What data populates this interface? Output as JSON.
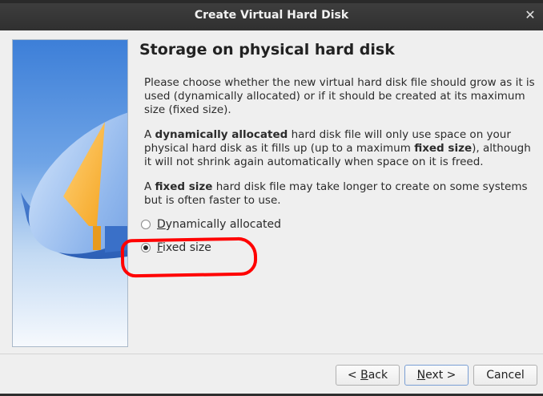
{
  "window": {
    "title": "Create Virtual Hard Disk",
    "close_icon": "close-icon"
  },
  "page": {
    "heading": "Storage on physical hard disk",
    "para1": "Please choose whether the new virtual hard disk file should grow as it is used (dynamically allocated) or if it should be created at its maximum size (fixed size).",
    "para2_prefix": "A ",
    "para2_bold1": "dynamically allocated",
    "para2_mid": " hard disk file will only use space on your physical hard disk as it fills up (up to a maximum ",
    "para2_bold2": "fixed size",
    "para2_suffix": "), although it will not shrink again automatically when space on it is freed.",
    "para3_prefix": "A ",
    "para3_bold": "fixed size",
    "para3_suffix": " hard disk file may take longer to create on some systems but is often faster to use."
  },
  "options": {
    "dynamic": {
      "label": "Dynamically allocated",
      "selected": false
    },
    "fixed": {
      "label": "Fixed size",
      "selected": true
    }
  },
  "buttons": {
    "back": {
      "lt": "< ",
      "key": "B",
      "rest": "ack"
    },
    "next": {
      "key": "N",
      "rest": "ext >"
    },
    "cancel": "Cancel"
  },
  "colors": {
    "annotation": "#ff0000",
    "titlebar": "#303030"
  }
}
